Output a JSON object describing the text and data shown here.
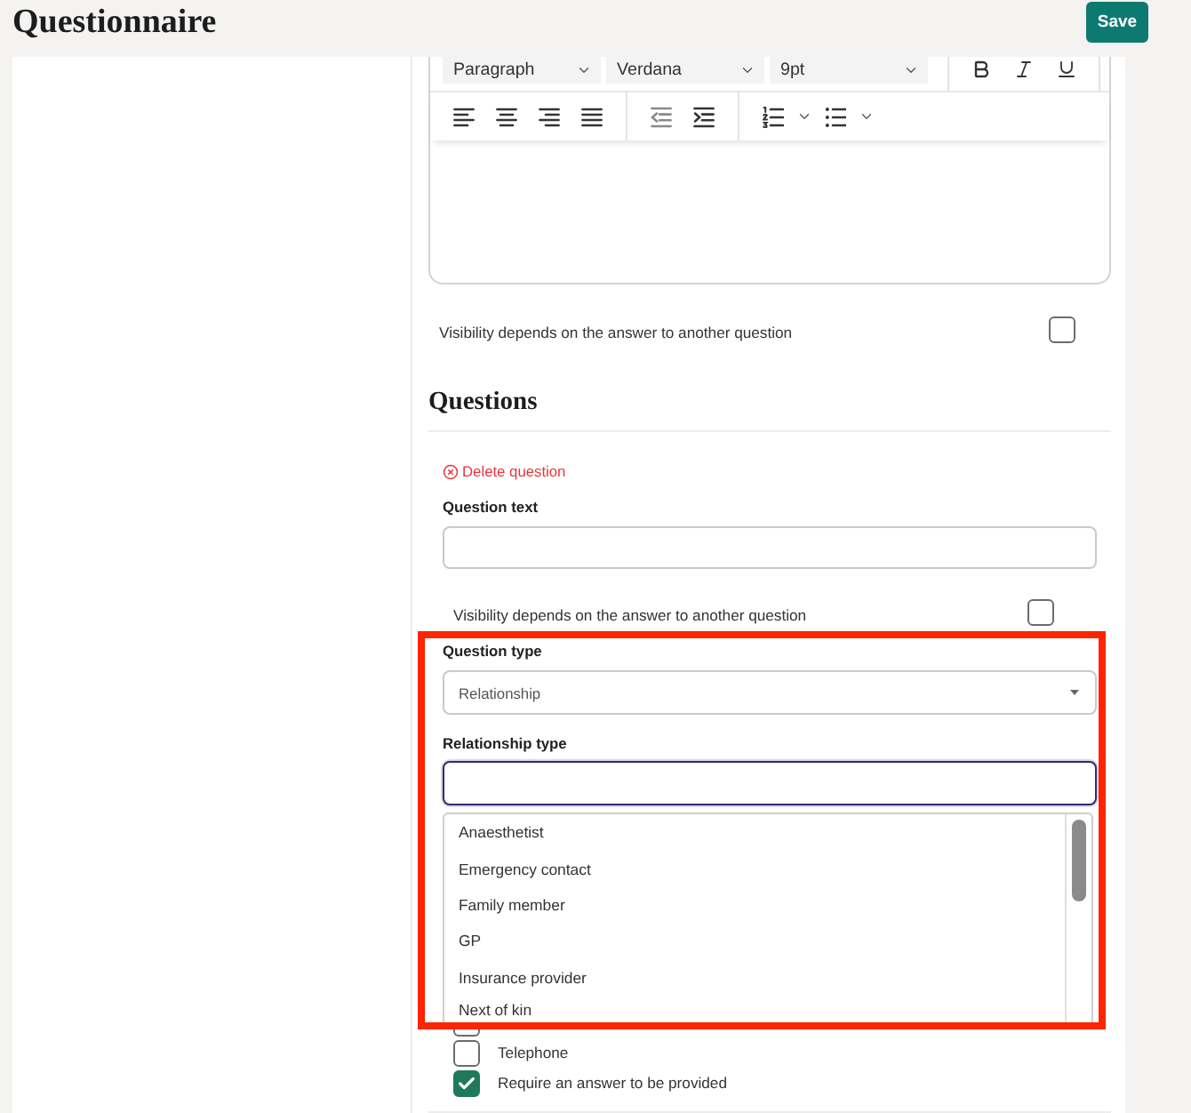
{
  "page": {
    "title": "Questionnaire"
  },
  "save_button": {
    "label": "Save"
  },
  "editor": {
    "selects": [
      {
        "value": "Paragraph"
      },
      {
        "value": "Verdana"
      },
      {
        "value": "9pt"
      }
    ]
  },
  "visibility": {
    "label": "Visibility depends on the answer to another question",
    "checked": false
  },
  "questions": {
    "heading": "Questions",
    "delete_label": "Delete question",
    "question_text": {
      "label": "Question text"
    },
    "visibility": {
      "label": "Visibility depends on the answer to another question",
      "checked": false
    },
    "question_type": {
      "label": "Question type",
      "value": "Relationship"
    },
    "relationship_type": {
      "label": "Relationship type",
      "focused": true,
      "expanded": true,
      "options": [
        {
          "label": "Anaesthetist",
          "selected": false
        },
        {
          "label": "Emergency contact",
          "selected": false
        },
        {
          "label": "Family member",
          "selected": false
        },
        {
          "label": "GP",
          "selected": false
        },
        {
          "label": "Insurance provider",
          "selected": false
        },
        {
          "label": "Next of kin",
          "selected": false
        }
      ]
    },
    "checkboxes": [
      {
        "checked": false
      },
      {
        "label": "Telephone",
        "checked": false
      },
      {
        "label": "Require an answer to be provided",
        "checked": true
      }
    ]
  }
}
